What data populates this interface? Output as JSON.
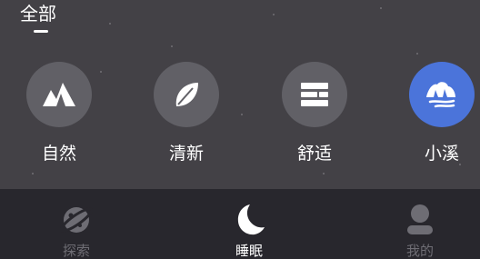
{
  "category": {
    "title": "全部"
  },
  "scenes": [
    {
      "label": "自然",
      "icon": "mountain-icon",
      "selected": false
    },
    {
      "label": "清新",
      "icon": "leaf-icon",
      "selected": false
    },
    {
      "label": "舒适",
      "icon": "bed-icon",
      "selected": false
    },
    {
      "label": "小溪",
      "icon": "stream-icon",
      "selected": true
    }
  ],
  "tabbar": {
    "tabs": [
      {
        "label": "探索",
        "icon": "planet-icon",
        "active": false
      },
      {
        "label": "睡眠",
        "icon": "moon-icon",
        "active": true
      },
      {
        "label": "我的",
        "icon": "person-icon",
        "active": false
      }
    ]
  },
  "colors": {
    "selected_scene": "#4b74da",
    "scene_circle": "#616066",
    "tabbar_bg": "#28272d",
    "inactive_tab": "#6e6d74"
  }
}
